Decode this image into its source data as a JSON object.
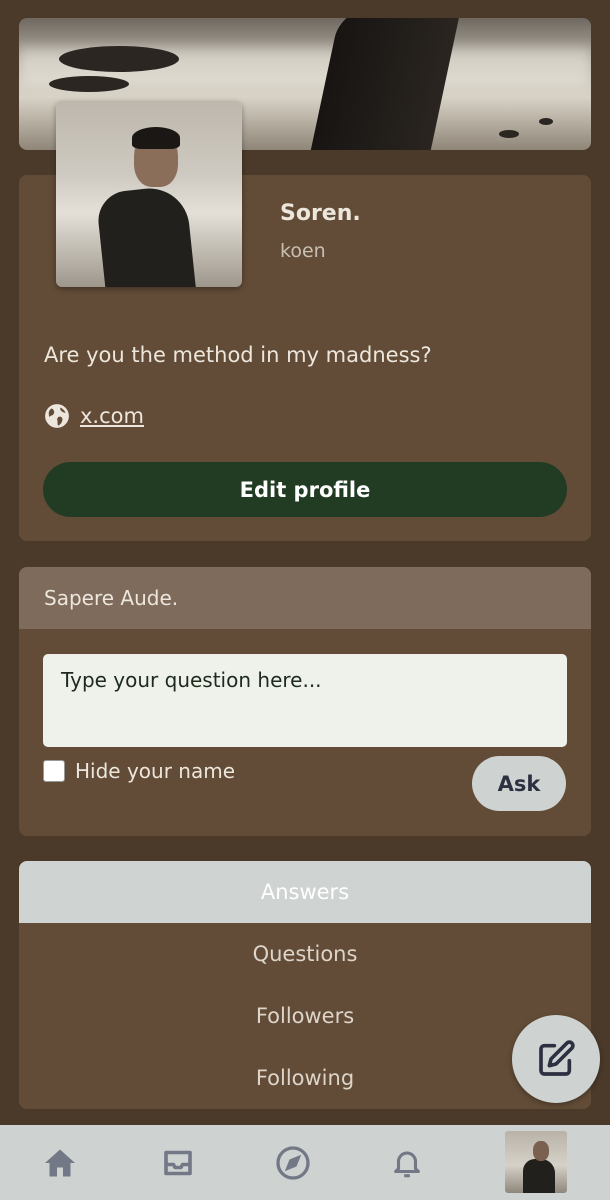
{
  "profile": {
    "display_name": "Soren.",
    "username": "koen",
    "bio": "Are you the method in my madness?",
    "website": "x.com",
    "edit_label": "Edit profile"
  },
  "ask": {
    "header": "Sapere Aude.",
    "placeholder": "Type your question here...",
    "hide_label": "Hide your name",
    "ask_label": "Ask",
    "hide_checked": false
  },
  "tabs": [
    {
      "label": "Answers",
      "active": true
    },
    {
      "label": "Questions",
      "active": false
    },
    {
      "label": "Followers",
      "active": false
    },
    {
      "label": "Following",
      "active": false
    }
  ],
  "nav": {
    "items": [
      "home-icon",
      "inbox-icon",
      "compass-icon",
      "bell-icon",
      "profile-avatar"
    ]
  },
  "colors": {
    "background": "#4b3a2a",
    "card": "#624c37",
    "primary_button": "#223b23",
    "light_surface": "#ced3d1"
  }
}
